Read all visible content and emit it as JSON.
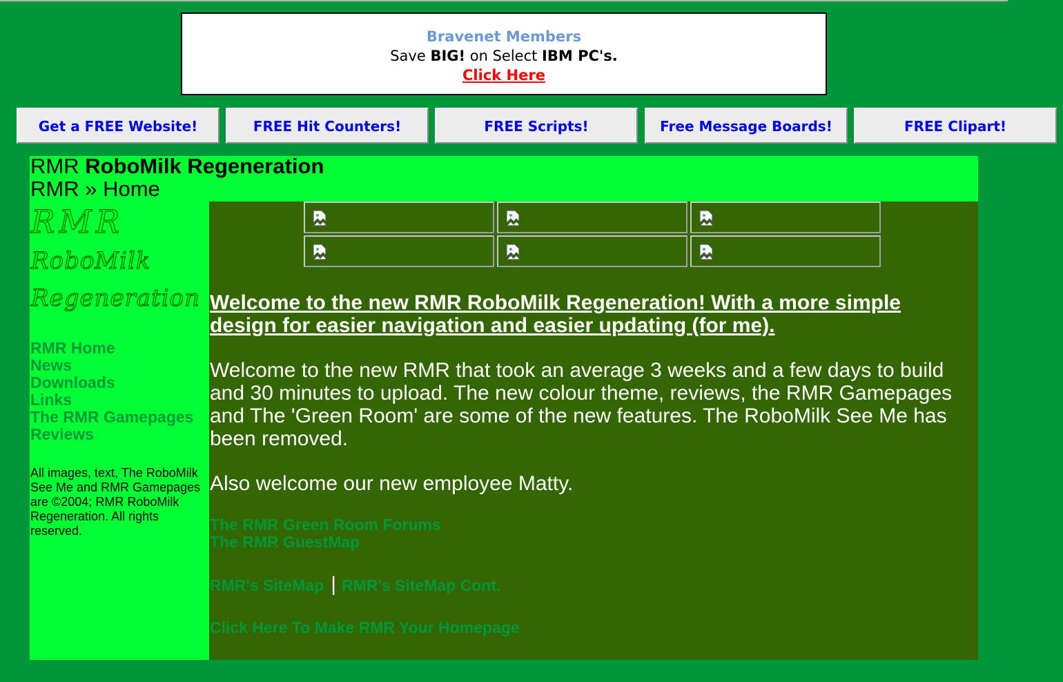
{
  "ad": {
    "title": "Bravenet Members",
    "line_pre": "Save ",
    "line_big": "BIG!",
    "line_mid": " on Select ",
    "line_brand": "IBM PC's.",
    "link": "Click Here"
  },
  "buttons": [
    {
      "label": "Get a FREE Website!"
    },
    {
      "label": "FREE Hit Counters!"
    },
    {
      "label": "FREE Scripts!"
    },
    {
      "label": "Free Message Boards!"
    },
    {
      "label": "FREE Clipart!"
    }
  ],
  "header": {
    "prefix": "RMR ",
    "site_name": "RoboMilk Regeneration",
    "breadcrumb": "RMR » Home"
  },
  "logo": {
    "line1": "RMR",
    "line2": "RoboMilk",
    "line3": "Regeneration"
  },
  "nav": [
    {
      "label": "RMR Home"
    },
    {
      "label": "News"
    },
    {
      "label": "Downloads"
    },
    {
      "label": "Links"
    },
    {
      "label": "The RMR Gamepages"
    },
    {
      "label": "Reviews"
    }
  ],
  "copyright": "All images, text, The RoboMilk See Me and RMR Gamepages are ©2004; RMR RoboMilk Regeneration. All rights reserved.",
  "content": {
    "heading": "Welcome to the new RMR RoboMilk Regeneration! With a more simple design for easier navigation and easier updating (for me).",
    "para1": "Welcome to the new RMR that took an average 3 weeks and a few days to build and 30 minutes to upload. The new colour theme, reviews, the RMR Gamepages and The 'Green Room' are some of the new features. The RoboMilk See Me has been removed.",
    "para2": "Also welcome our new employee Matty.",
    "forums_link": "The RMR Green Room Forums",
    "guestmap_link": "The RMR GuestMap",
    "sitemap_link": "RMR's SiteMap",
    "separator": "|",
    "sitemap_cont_link": "RMR's SiteMap Cont.",
    "homepage_link": "Click Here To Make RMR Your Homepage"
  },
  "colors": {
    "page_bg": "#00963a",
    "header_bg": "#00ff33",
    "content_bg": "#336600",
    "link_blue": "#0000ee",
    "ad_title": "#6b9bd2",
    "ad_link": "#ff0000"
  },
  "icons": {
    "broken_image": "broken-image-icon"
  }
}
